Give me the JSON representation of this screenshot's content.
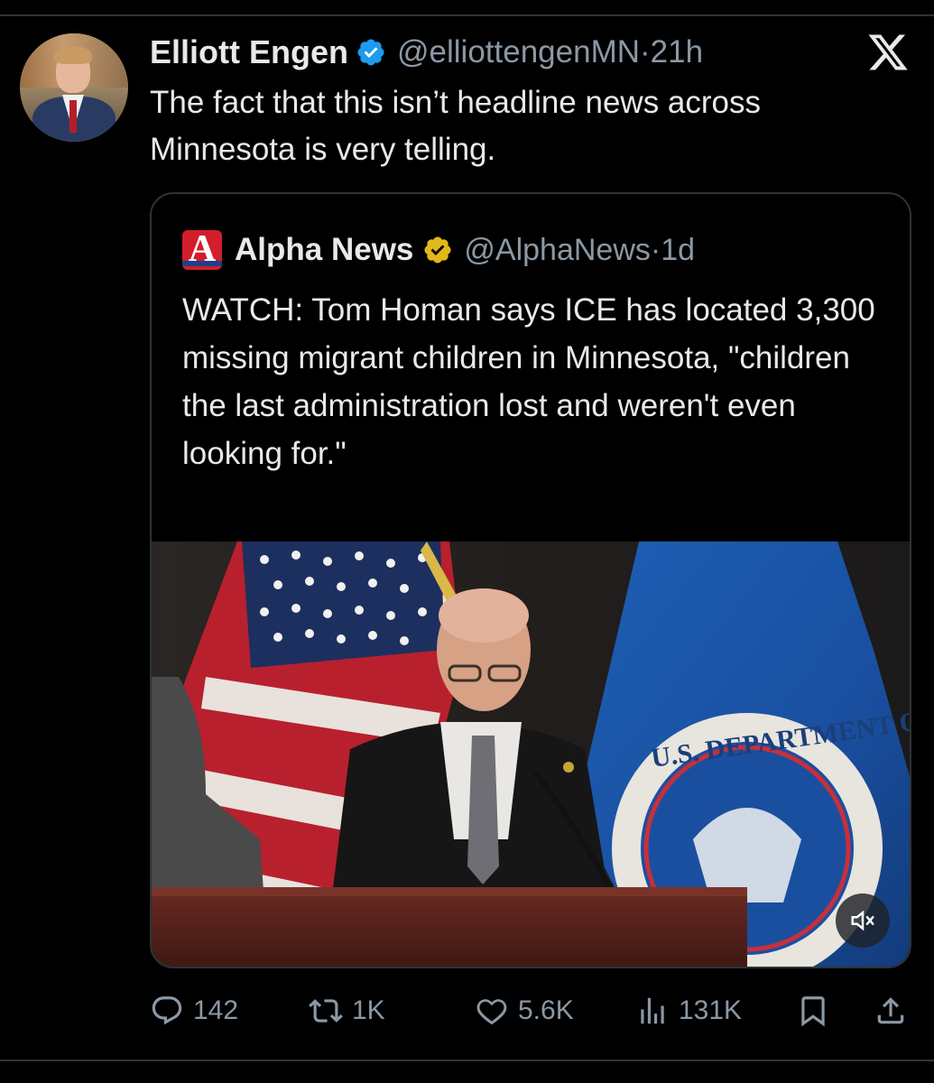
{
  "tweet": {
    "author_name": "Elliott Engen",
    "handle": "@elliottengenMN",
    "separator": "·",
    "time": "21h",
    "text": "The fact that this isn’t headline news across Minnesota is very telling.",
    "verified_badge_color": "#1d9bf0",
    "platform_icon": "x-logo-icon"
  },
  "quoted": {
    "logo_letter": "A",
    "name": "Alpha News",
    "handle": "@AlphaNews",
    "separator": "·",
    "time": "1d",
    "badge_color": "#e2b719",
    "text": "WATCH: Tom Homan says ICE has located 3,300 missing migrant children in Minnesota, \"children the last administration lost and weren't even looking for.\"",
    "media": {
      "seal_text": "U.S. DEPARTMENT O",
      "sound_icon": "speaker-muted-icon"
    }
  },
  "actions": {
    "replies": "142",
    "reposts": "1K",
    "likes": "5.6K",
    "views": "131K"
  },
  "colors": {
    "background": "#000000",
    "text": "#e7e9ea",
    "secondary": "#8b98a5",
    "border": "#2f3336"
  }
}
